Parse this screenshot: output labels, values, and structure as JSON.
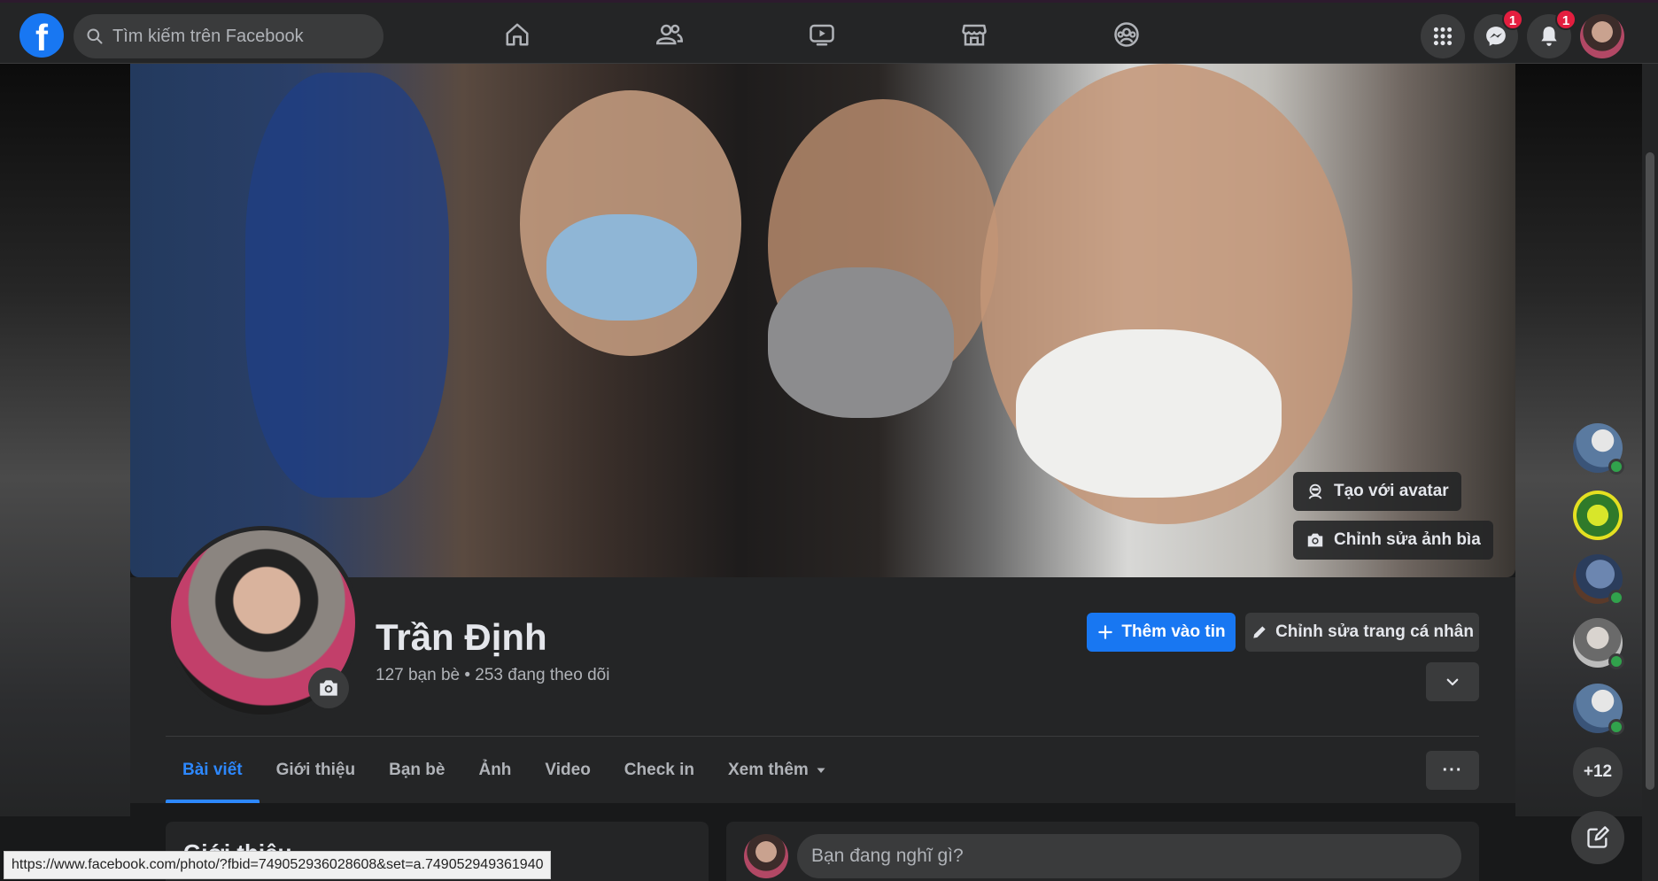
{
  "topbar": {
    "logo_letter": "f",
    "search_placeholder": "Tìm kiếm trên Facebook",
    "nav_icons": [
      "home-icon",
      "friends-icon",
      "watch-icon",
      "marketplace-icon",
      "groups-icon"
    ],
    "messenger_badge": "1",
    "notifications_badge": "1"
  },
  "cover": {
    "avatar_button_label": "Tạo với avatar",
    "edit_cover_label": "Chỉnh sửa ảnh bìa"
  },
  "profile": {
    "name": "Trần Định",
    "stats": "127 bạn bè • 253 đang theo dõi",
    "add_story_label": "Thêm vào tin",
    "edit_profile_label": "Chỉnh sửa trang cá nhân"
  },
  "tabs": [
    {
      "label": "Bài viết",
      "active": true
    },
    {
      "label": "Giới thiệu",
      "active": false
    },
    {
      "label": "Bạn bè",
      "active": false
    },
    {
      "label": "Ảnh",
      "active": false
    },
    {
      "label": "Video",
      "active": false
    },
    {
      "label": "Check in",
      "active": false
    },
    {
      "label": "Xem thêm",
      "active": false
    }
  ],
  "more_button_label": "···",
  "intro_card": {
    "title": "Giới thiệu"
  },
  "composer": {
    "placeholder": "Bạn đang nghĩ gì?"
  },
  "contacts": {
    "more_label": "+12"
  },
  "status_bar": {
    "url": "https://www.facebook.com/photo/?fbid=749052936028608&set=a.749052949361940"
  },
  "colors": {
    "accent": "#1877f2",
    "tab_active": "#2d88ff",
    "badge": "#e41e3f",
    "online": "#31a24c"
  }
}
